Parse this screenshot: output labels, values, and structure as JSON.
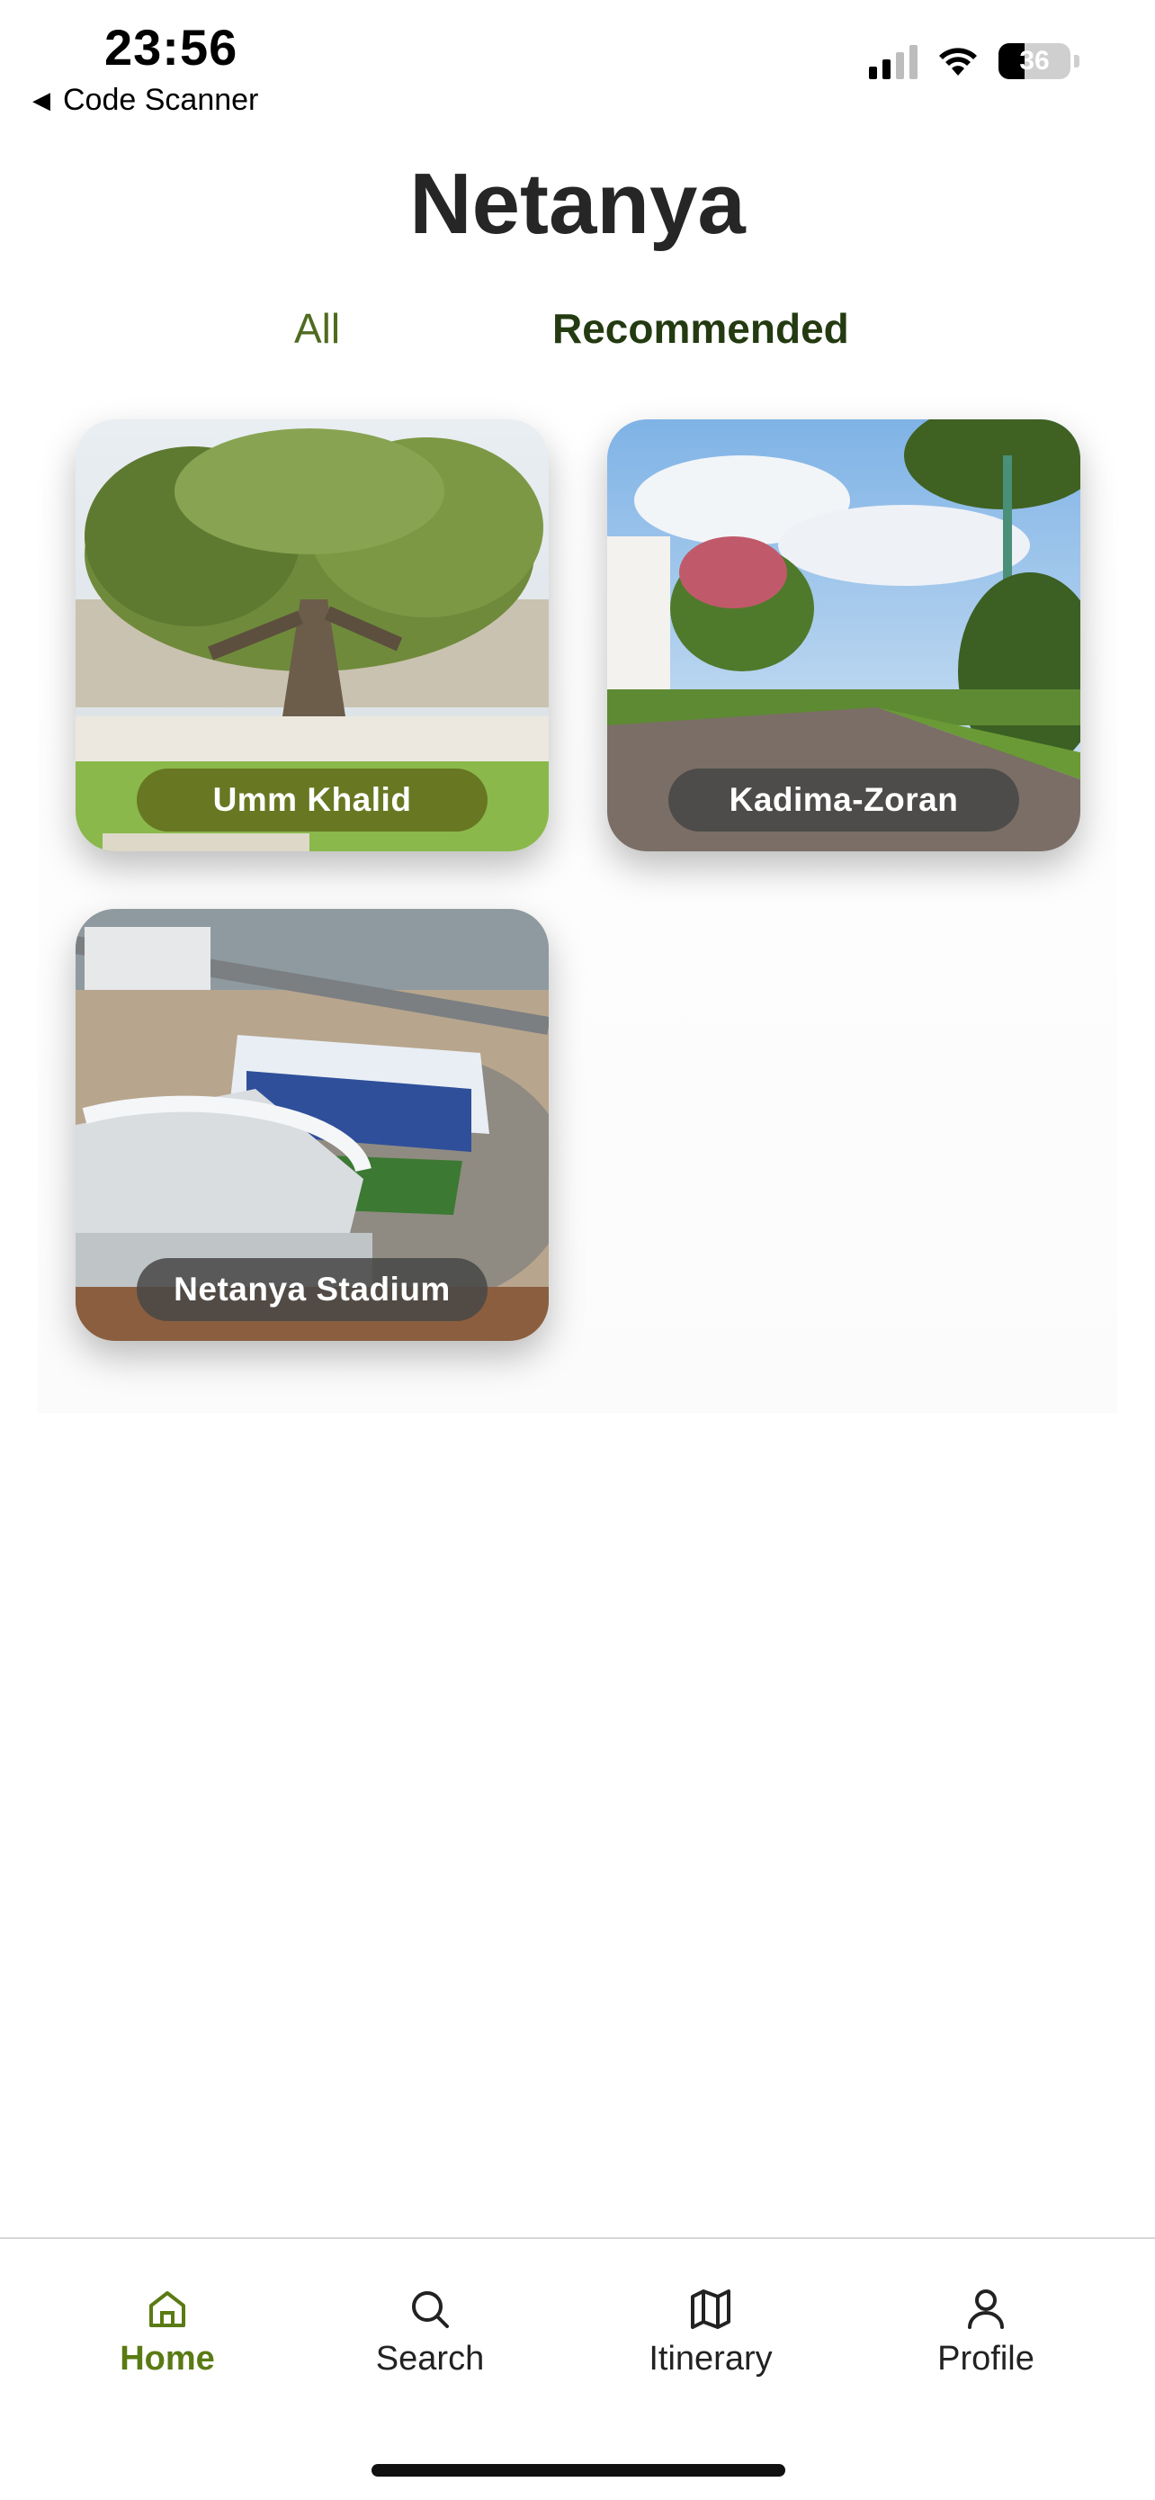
{
  "status_bar": {
    "time": "23:56",
    "back_label": "Code Scanner",
    "battery_level": "36",
    "signal_bars": 2,
    "icons": [
      "signal-icon",
      "wifi-icon",
      "battery-icon"
    ]
  },
  "header": {
    "title": "Netanya"
  },
  "tabs": [
    {
      "label": "All",
      "active": false
    },
    {
      "label": "Recommended",
      "active": true
    }
  ],
  "places": [
    {
      "name": "Umm Khalid",
      "image": "tree-park-photo"
    },
    {
      "name": "Kadima-Zoran",
      "image": "street-photo"
    },
    {
      "name": "Netanya Stadium",
      "image": "stadium-aerial-photo"
    }
  ],
  "bottom_nav": [
    {
      "label": "Home",
      "icon": "home-icon",
      "active": true
    },
    {
      "label": "Search",
      "icon": "search-icon",
      "active": false
    },
    {
      "label": "Itinerary",
      "icon": "map-icon",
      "active": false
    },
    {
      "label": "Profile",
      "icon": "person-icon",
      "active": false
    }
  ],
  "colors": {
    "accent": "#5a7a14",
    "tab_active": "#243b12",
    "tab_inactive": "#4f6b1f"
  }
}
